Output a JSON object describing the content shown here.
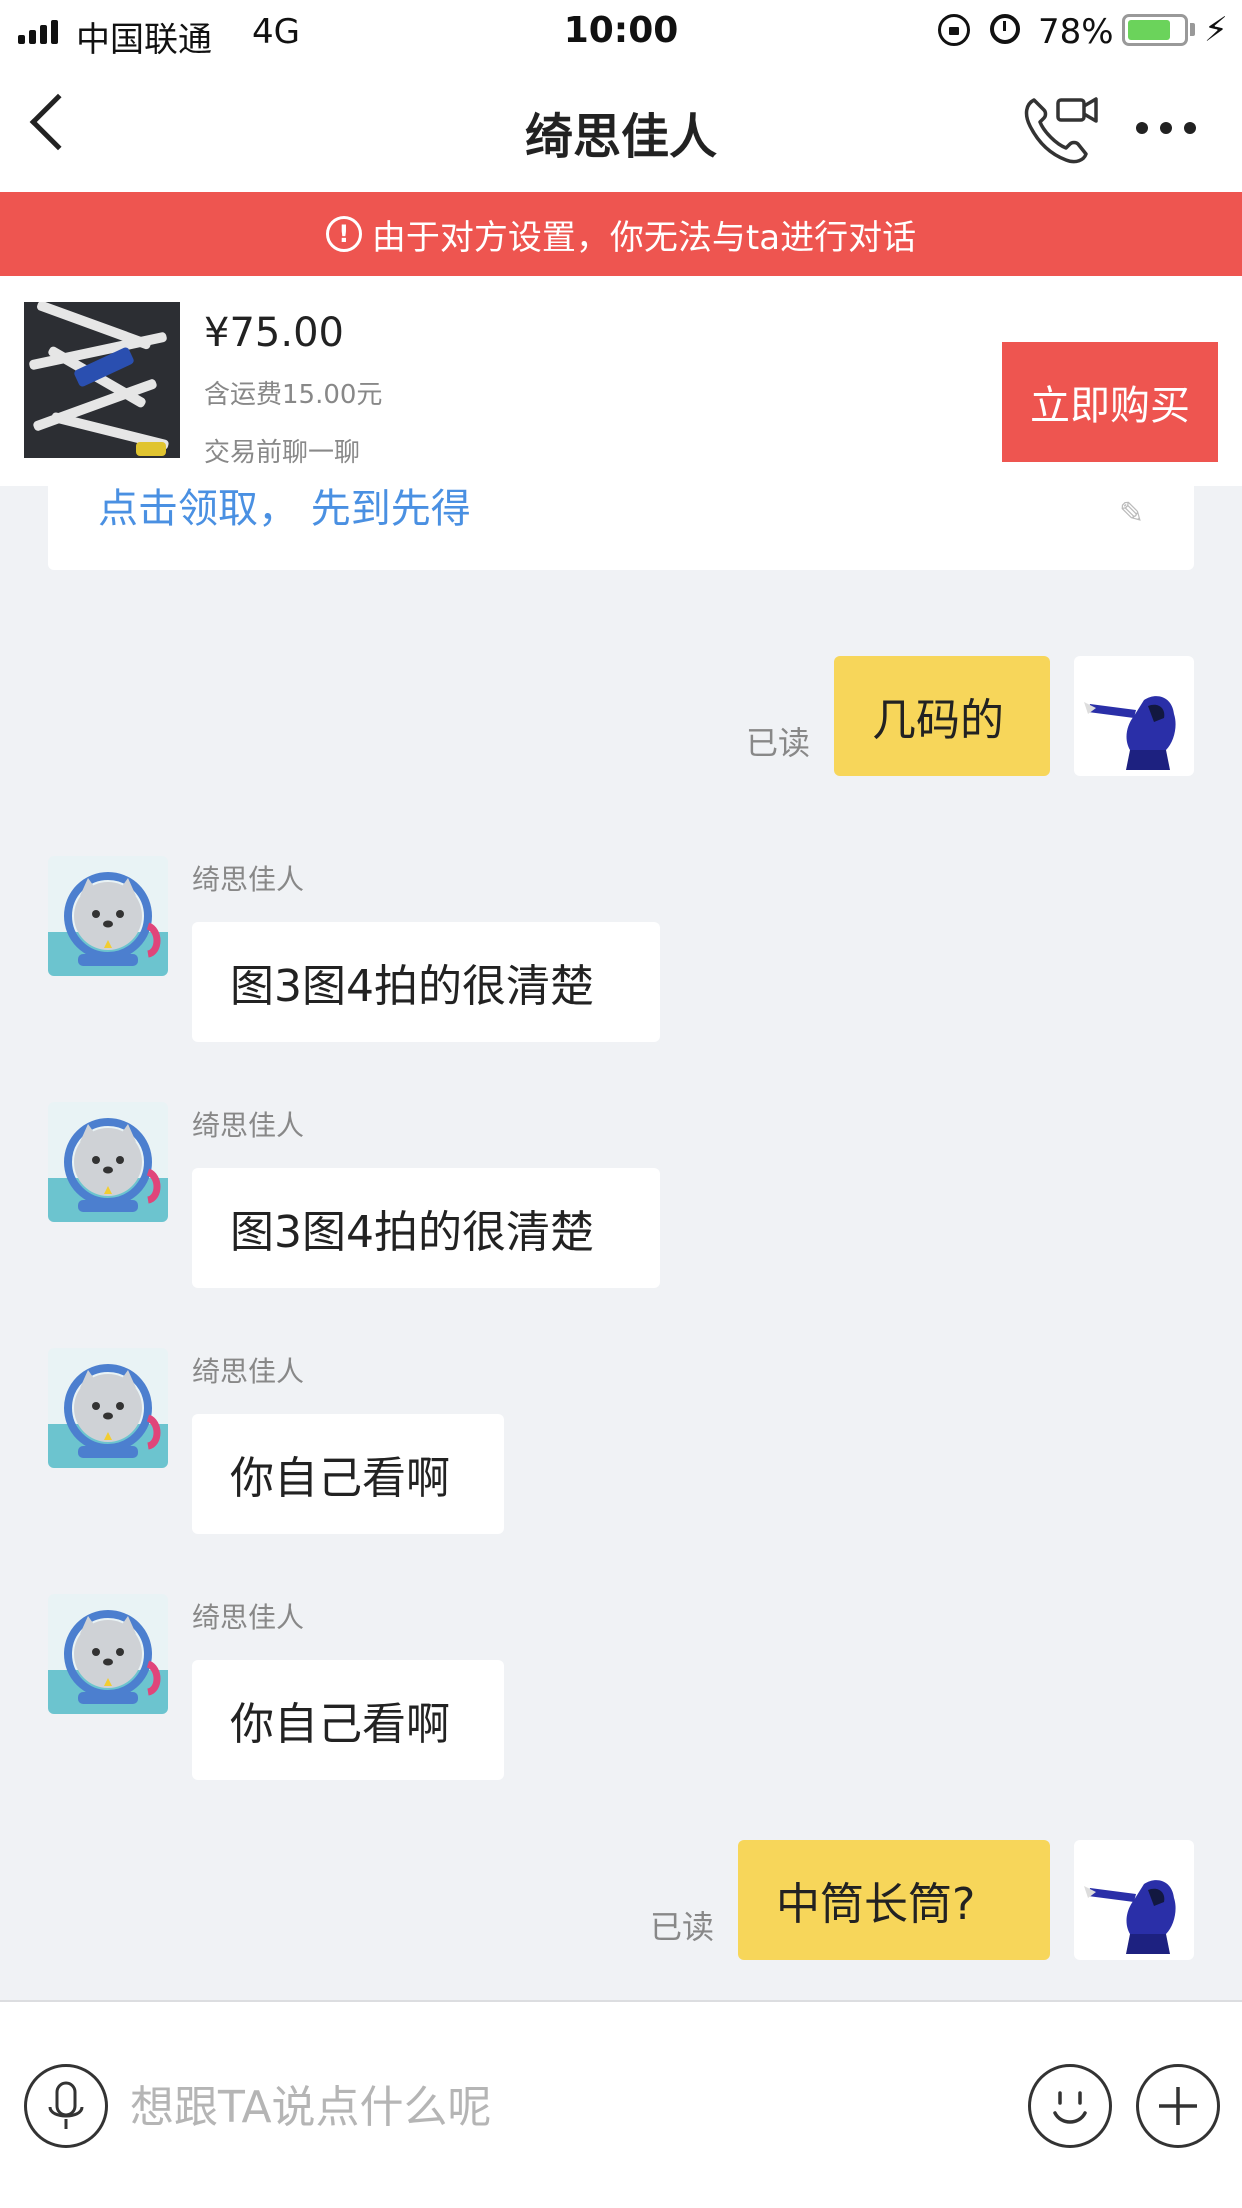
{
  "status_bar": {
    "carrier": "中国联通",
    "network": "4G",
    "time": "10:00",
    "battery_percent": "78%",
    "battery_level": 0.78
  },
  "nav": {
    "title": "绮思佳人",
    "icons": [
      "back-icon",
      "video-call-icon",
      "more-icon"
    ]
  },
  "banner": {
    "icon": "!",
    "text": "由于对方设置，你无法与ta进行对话",
    "color": "#ee5550"
  },
  "product": {
    "price": "¥75.00",
    "shipping": "含运费15.00元",
    "note": "交易前聊一聊",
    "buy_label": "立即购买"
  },
  "chat": {
    "coupon_text": "点击领取， 先到先得",
    "messages": [
      {
        "side": "right",
        "text": "几码的",
        "status": "已读"
      },
      {
        "side": "left",
        "sender": "绮思佳人",
        "text": "图3图4拍的很清楚"
      },
      {
        "side": "left",
        "sender": "绮思佳人",
        "text": "图3图4拍的很清楚"
      },
      {
        "side": "left",
        "sender": "绮思佳人",
        "text": "你自己看啊"
      },
      {
        "side": "left",
        "sender": "绮思佳人",
        "text": "你自己看啊"
      },
      {
        "side": "right",
        "text": "中筒长筒?",
        "status": "已读"
      }
    ]
  },
  "input": {
    "placeholder": "想跟TA说点什么呢"
  },
  "colors": {
    "accent_red": "#ee5550",
    "own_bubble": "#f7d65a",
    "link_blue": "#4a90e2",
    "background": "#f0f2f5"
  }
}
